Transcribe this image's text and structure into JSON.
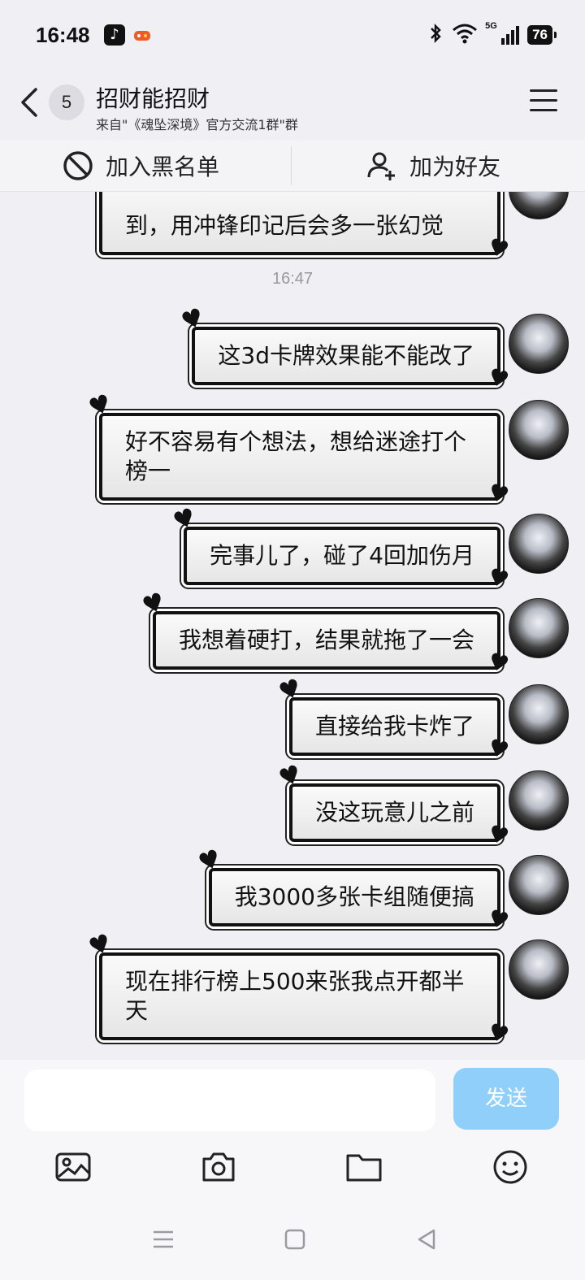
{
  "status_bar": {
    "time": "16:48",
    "network": "5G",
    "battery": "76",
    "icons": [
      "tiktok-icon",
      "game-icon",
      "bluetooth-icon",
      "wifi-icon",
      "signal-icon",
      "battery-icon"
    ]
  },
  "header": {
    "unread_count": "5",
    "title": "招财能招财",
    "subtitle": "来自\"《魂坠深境》官方交流1群\"群"
  },
  "actions": {
    "block_label": "加入黑名单",
    "add_friend_label": "加为好友"
  },
  "chat": {
    "partial_top_message": "到，用冲锋印记后会多一张幻觉",
    "timestamp": "16:47",
    "messages": [
      {
        "text": "这3d卡牌效果能不能改了"
      },
      {
        "text": "好不容易有个想法，想给迷途打个榜一"
      },
      {
        "text": "完事儿了，碰了4回加伤月"
      },
      {
        "text": "我想着硬打，结果就拖了一会"
      },
      {
        "text": "直接给我卡炸了"
      },
      {
        "text": "没这玩意儿之前"
      },
      {
        "text": "我3000多张卡组随便搞"
      },
      {
        "text": "现在排行榜上500来张我点开都半天"
      }
    ]
  },
  "composer": {
    "input_value": "",
    "send_label": "发送",
    "tools": [
      "image-icon",
      "camera-icon",
      "folder-icon",
      "emoji-icon"
    ]
  },
  "colors": {
    "background": "#efeff4",
    "send_button": "#8fcff9",
    "bubble_border": "#111111"
  }
}
